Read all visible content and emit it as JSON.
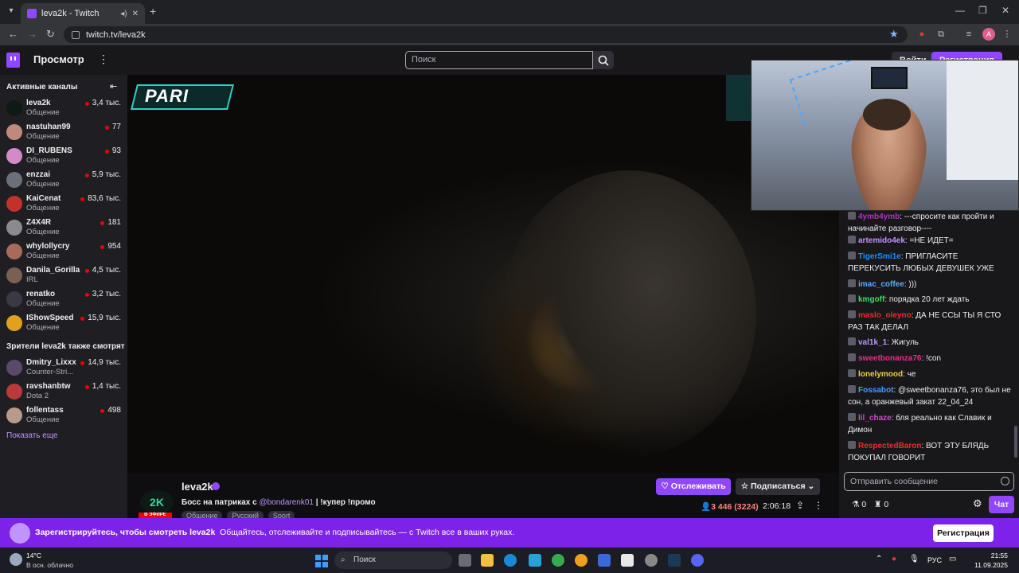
{
  "browser": {
    "tab_title": "leva2k - Twitch",
    "url": "twitch.tv/leva2k"
  },
  "twitch_nav": {
    "browse_label": "Просмотр",
    "search_placeholder": "Поиск",
    "login_label": "Войти",
    "signup_label": "Регистрация"
  },
  "sidebar": {
    "active_title": "Активные каналы",
    "active_channels": [
      {
        "name": "leva2k",
        "category": "Общение",
        "viewers": "3,4 тыс.",
        "color": "#0e1a16"
      },
      {
        "name": "nastuhan99",
        "category": "Общение",
        "viewers": "77",
        "color": "#c08a7a"
      },
      {
        "name": "DI_RUBENS",
        "category": "Общение",
        "viewers": "93",
        "color": "#d48ac8"
      },
      {
        "name": "enzzai",
        "category": "Общение",
        "viewers": "5,9 тыс.",
        "color": "#6a6f7a"
      },
      {
        "name": "KaiCenat",
        "category": "Общение",
        "viewers": "83,6 тыс.",
        "color": "#c0322a"
      },
      {
        "name": "Z4X4R",
        "category": "Общение",
        "viewers": "181",
        "color": "#8a8a90"
      },
      {
        "name": "whylollycry",
        "category": "Общение",
        "viewers": "954",
        "color": "#a86a5a"
      },
      {
        "name": "Danila_Gorilla",
        "category": "IRL",
        "viewers": "4,5 тыс.",
        "color": "#7a6050"
      },
      {
        "name": "renatko",
        "category": "Общение",
        "viewers": "3,2 тыс.",
        "color": "#3a3a44"
      },
      {
        "name": "IShowSpeed",
        "category": "Общение",
        "viewers": "15,9 тыс.",
        "color": "#e0a020"
      }
    ],
    "also_title": "Зрители leva2k также смотрят",
    "also_channels": [
      {
        "name": "Dmitry_Lixxx",
        "category": "Counter-Stri...",
        "viewers": "14,9 тыс.",
        "color": "#5a4a6a"
      },
      {
        "name": "ravshanbtw",
        "category": "Dota 2",
        "viewers": "1,4 тыс.",
        "color": "#b83a3a"
      },
      {
        "name": "follentass",
        "category": "Общение",
        "viewers": "498",
        "color": "#b89a8a"
      }
    ],
    "show_more": "Показать еще"
  },
  "video": {
    "sponsor_logo": "PARI"
  },
  "stream": {
    "avatar_text": "2K",
    "live_badge": "В ЭФИРЕ",
    "channel_name": "leva2k",
    "title_prefix": "Босс на патриках с ",
    "title_mention": "@bondarenk01",
    "title_suffix": " | !купер !промо",
    "tags": [
      "Общение",
      "Русский",
      "Sport"
    ],
    "follow_label": "Отслеживать",
    "subscribe_label": "Подписаться",
    "viewers": "3 446 (3224)",
    "uptime": "2:06:18"
  },
  "chat": {
    "messages": [
      {
        "user": "4ymb4ymb",
        "color": "#b52dce",
        "text": "---спросите как пройти и начинайте разговор----"
      },
      {
        "user": "artemido4ek",
        "color": "#bf94ff",
        "text": "=НЕ ИДЕТ="
      },
      {
        "user": "TigerSmi1e",
        "color": "#1e90ff",
        "text": "ПРИГЛАСИТЕ ПЕРЕКУСИТЬ ЛЮБЫХ ДЕВУШЕК УЖЕ"
      },
      {
        "user": "imac_coffee",
        "color": "#5fa8ff",
        "text": ")))"
      },
      {
        "user": "kmgoff",
        "color": "#3adf6a",
        "text": "порядка 20 лет ждать"
      },
      {
        "user": "maslo_oleyno",
        "color": "#eb2d2d",
        "text": "ДА НЕ ССЫ ТЫ Я СТО РАЗ ТАК ДЕЛАЛ"
      },
      {
        "user": "val1k_1",
        "color": "#bf94ff",
        "text": "Жигуль"
      },
      {
        "user": "sweetbonanza76",
        "color": "#eb2d8c",
        "text": "!con"
      },
      {
        "user": "lonelymood",
        "color": "#f0d040",
        "text": "че"
      },
      {
        "user": "Fossabot",
        "color": "#4a9aff",
        "text": "@sweetbonanza76, это был не сон, а оранжевый закат 22_04_24"
      },
      {
        "user": "lil_chaze",
        "color": "#d04ad0",
        "text": "бля реально как Славик и Димон"
      },
      {
        "user": "RespectedBaron",
        "color": "#eb2d2d",
        "text": "ВОТ ЭТУ БЛЯДЬ ПОКУПАЛ ГОВОРИТ"
      }
    ],
    "input_placeholder": "Отправить сообщение",
    "points": "0",
    "bits": "0",
    "chat_button": "Чат"
  },
  "banner": {
    "bold_text": "Зарегистрируйтесь, чтобы смотреть leva2k",
    "text": "Общайтесь, отслеживайте и подписывайтесь — с Twitch все в ваших руках.",
    "button": "Регистрация"
  },
  "taskbar": {
    "temperature": "14°C",
    "weather": "В осн. облачно",
    "search": "Поиск",
    "lang": "РУС",
    "time": "21:55",
    "date": "11.09.2025"
  }
}
